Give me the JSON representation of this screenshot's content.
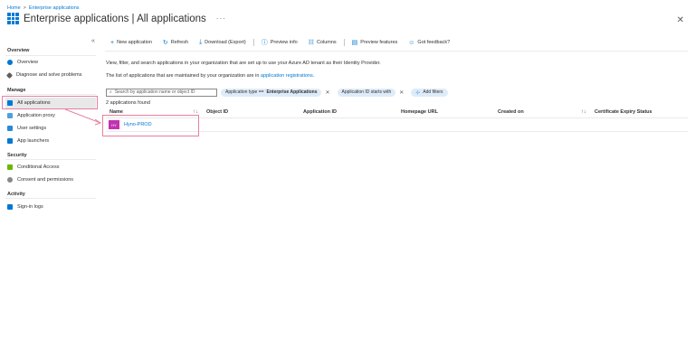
{
  "breadcrumb": {
    "home": "Home",
    "separator": ">",
    "current": "Enterprise applications"
  },
  "header": {
    "title": "Enterprise applications | All applications",
    "more": "···",
    "close": "✕"
  },
  "sidebar": {
    "collapse": "«",
    "sections": [
      {
        "title": "Overview",
        "items": [
          "Overview",
          "Diagnose and solve problems"
        ]
      },
      {
        "title": "Manage",
        "items": [
          "All applications",
          "Application proxy",
          "User settings",
          "App launchers"
        ]
      },
      {
        "title": "Security",
        "items": [
          "Conditional Access",
          "Consent and permissions"
        ]
      },
      {
        "title": "Activity",
        "items": [
          "Sign-in logs"
        ]
      }
    ],
    "active_item": "All applications"
  },
  "toolbar": {
    "new_application": "New application",
    "refresh": "Refresh",
    "download": "Download (Export)",
    "preview_info": "Preview info",
    "columns": "Columns",
    "preview_features": "Preview features",
    "feedback": "Got feedback?"
  },
  "description": {
    "line1": "View, filter, and search applications in your organization that are set up to use your Azure AD tenant as their Identity Provider.",
    "line2_prefix": "The list of applications that are maintained by your organization are in",
    "line2_link": "application registrations",
    "line2_suffix": "."
  },
  "filters": {
    "search_placeholder": "Search by application name or object ID",
    "pill1_label": "Application type ==",
    "pill1_value": "Enterprise Applications",
    "pill2_label": "Application ID starts with",
    "add_filters": "Add filters"
  },
  "results": {
    "count_text": "2 applications found"
  },
  "table": {
    "columns": [
      "Name",
      "Object ID",
      "Application ID",
      "Homepage URL",
      "Created on",
      "Certificate Expiry Status"
    ],
    "rows": [
      {
        "initials": "HY",
        "name": "Hyno-PROD"
      }
    ]
  },
  "colors": {
    "accent": "#0078d4",
    "highlight": "#e87fa1",
    "avatar": "#b4009e",
    "pill": "#deecf9"
  }
}
